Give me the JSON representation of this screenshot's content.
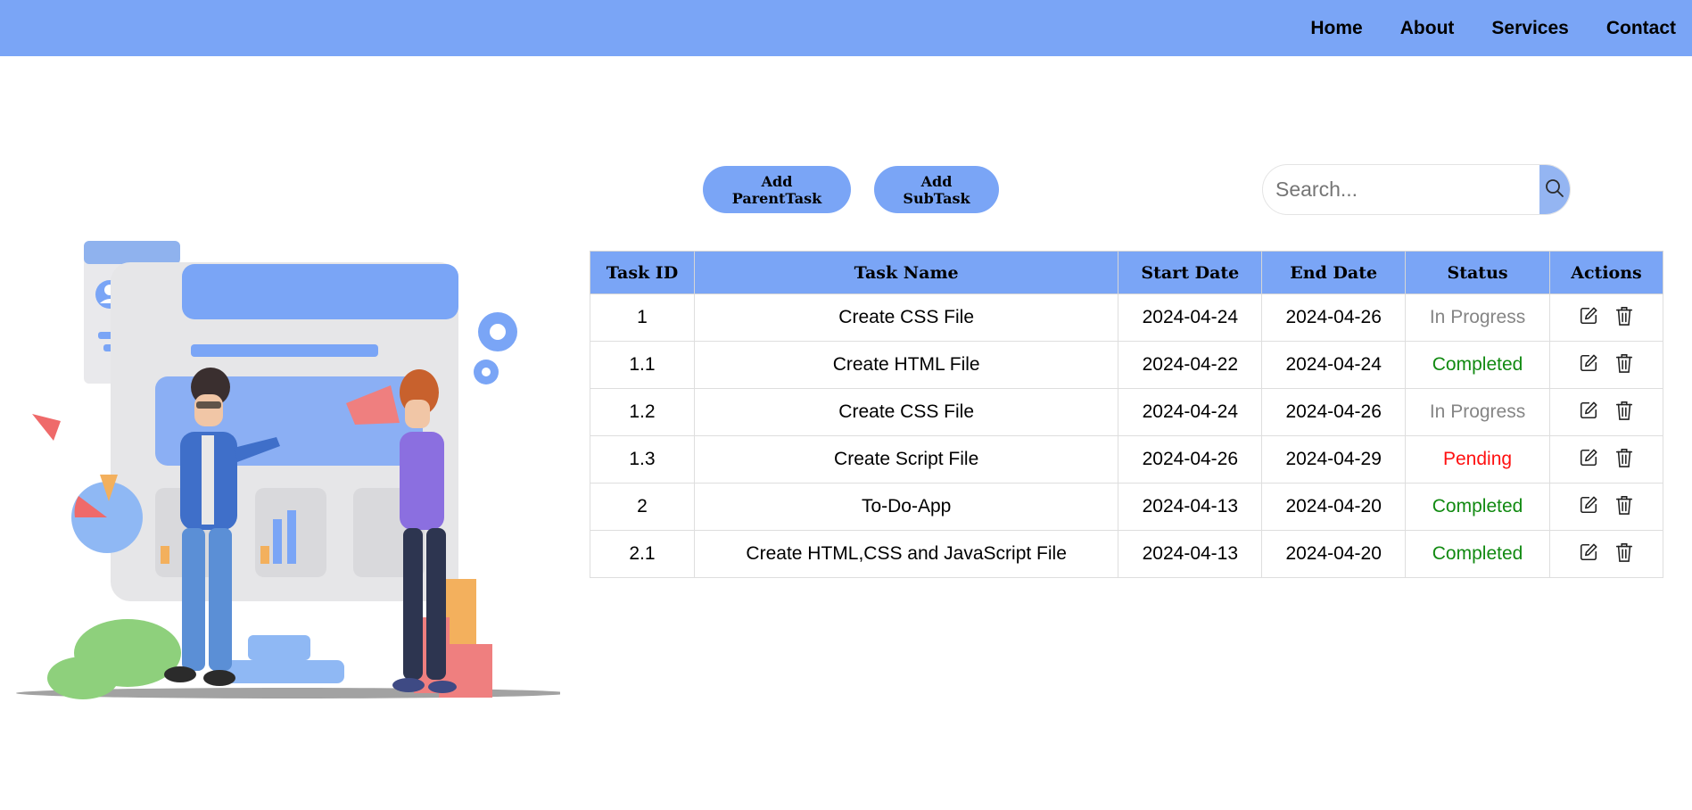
{
  "nav": {
    "items": [
      {
        "label": "Home"
      },
      {
        "label": "About"
      },
      {
        "label": "Services"
      },
      {
        "label": "Contact"
      }
    ]
  },
  "toolbar": {
    "add_parent_label": "Add ParentTask",
    "add_sub_label": "Add SubTask"
  },
  "search": {
    "placeholder": "Search...",
    "value": "",
    "icon": "search-icon"
  },
  "table": {
    "headers": [
      "Task ID",
      "Task Name",
      "Start Date",
      "End Date",
      "Status",
      "Actions"
    ],
    "rows": [
      {
        "id": "1",
        "name": "Create CSS File",
        "start": "2024-04-24",
        "end": "2024-04-26",
        "status": "In Progress"
      },
      {
        "id": "1.1",
        "name": "Create HTML File",
        "start": "2024-04-22",
        "end": "2024-04-24",
        "status": "Completed"
      },
      {
        "id": "1.2",
        "name": "Create CSS File",
        "start": "2024-04-24",
        "end": "2024-04-26",
        "status": "In Progress"
      },
      {
        "id": "1.3",
        "name": "Create Script File",
        "start": "2024-04-26",
        "end": "2024-04-29",
        "status": "Pending"
      },
      {
        "id": "2",
        "name": "To-Do-App",
        "start": "2024-04-13",
        "end": "2024-04-20",
        "status": "Completed"
      },
      {
        "id": "2.1",
        "name": "Create HTML,CSS and JavaScript File",
        "start": "2024-04-13",
        "end": "2024-04-20",
        "status": "Completed"
      }
    ],
    "action_icons": [
      "edit-icon",
      "trash-icon"
    ]
  },
  "colors": {
    "brand": "#7aa5f6",
    "search_button": "#94b5f2",
    "status_in_progress": "#858585",
    "status_completed": "#118a11",
    "status_pending": "#ff1010"
  }
}
